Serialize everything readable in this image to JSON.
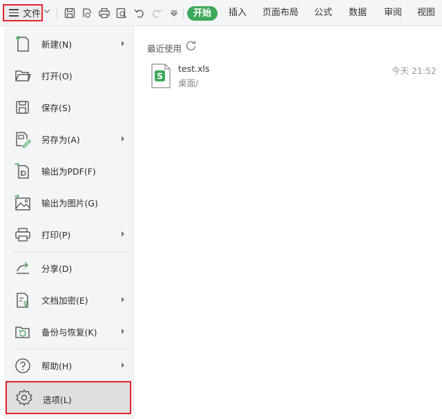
{
  "toolbar": {
    "file_label": "文件",
    "tabs": [
      {
        "label": "开始",
        "active": true
      },
      {
        "label": "插入"
      },
      {
        "label": "页面布局"
      },
      {
        "label": "公式"
      },
      {
        "label": "数据"
      },
      {
        "label": "审阅"
      },
      {
        "label": "视图"
      }
    ],
    "quick_icons": [
      "save-icon",
      "export-icon",
      "print-icon",
      "print-preview-icon",
      "undo-icon",
      "redo-icon",
      "customize-icon"
    ],
    "accent_color": "#3ea85b"
  },
  "menu": {
    "items": [
      {
        "label": "新建(N)",
        "icon": "new-file-icon",
        "submenu": true
      },
      {
        "label": "打开(O)",
        "icon": "open-folder-icon",
        "submenu": false
      },
      {
        "label": "保存(S)",
        "icon": "save-icon",
        "submenu": false
      },
      {
        "label": "另存为(A)",
        "icon": "save-as-icon",
        "submenu": true
      },
      {
        "label": "输出为PDF(F)",
        "icon": "export-pdf-icon",
        "submenu": false
      },
      {
        "label": "输出为图片(G)",
        "icon": "export-image-icon",
        "submenu": false
      },
      {
        "label": "打印(P)",
        "icon": "print-icon",
        "submenu": true
      },
      {
        "label": "分享(D)",
        "icon": "share-icon",
        "submenu": false
      },
      {
        "label": "文档加密(E)",
        "icon": "encrypt-icon",
        "submenu": true
      },
      {
        "label": "备份与恢复(K)",
        "icon": "backup-icon",
        "submenu": true
      },
      {
        "label": "帮助(H)",
        "icon": "help-icon",
        "submenu": true
      },
      {
        "label": "选项(L)",
        "icon": "gear-icon",
        "submenu": false,
        "selected": true
      }
    ],
    "highlight_color": "#e0242d"
  },
  "recent": {
    "title": "最近使用",
    "files": [
      {
        "name": "test.xls",
        "path": "桌面/",
        "time": "今天 21:52",
        "icon": "spreadsheet-file-icon"
      }
    ]
  }
}
